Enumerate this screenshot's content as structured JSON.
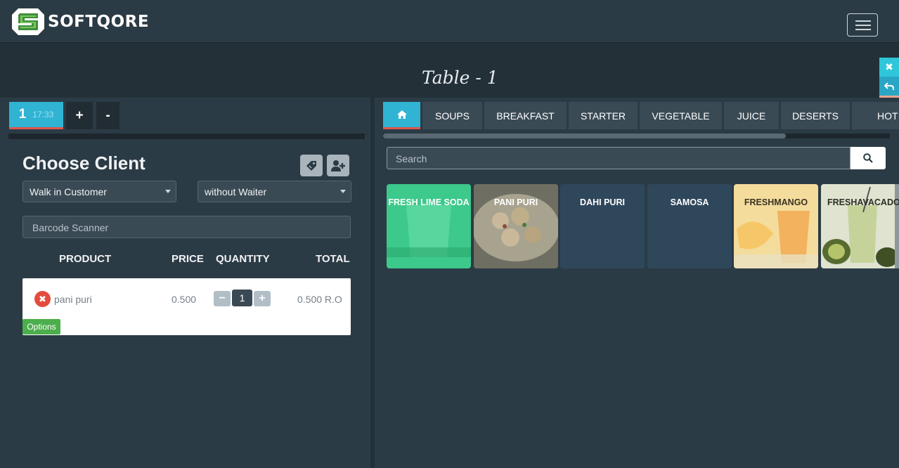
{
  "brand": {
    "name": "SOFTQORE"
  },
  "page": {
    "table_title": "Table - 1"
  },
  "order_tabs": {
    "active_number": "1",
    "active_time": "17:33",
    "add_label": "+",
    "remove_label": "-"
  },
  "client": {
    "heading": "Choose Client",
    "customer_select": "Walk in Customer",
    "waiter_select": "without Waiter",
    "barcode_placeholder": "Barcode Scanner"
  },
  "cart": {
    "columns": [
      "PRODUCT",
      "PRICE",
      "QUANTITY",
      "TOTAL"
    ],
    "items": [
      {
        "name": "pani puri",
        "price": "0.500",
        "quantity": "1",
        "total": "0.500 R.O",
        "options_label": "Options"
      }
    ]
  },
  "categories": [
    "SOUPS",
    "BREAKFAST",
    "STARTER",
    "VEGETABLE",
    "JUICE",
    "DESERTS",
    "HOT"
  ],
  "search": {
    "placeholder": "Search"
  },
  "products": [
    {
      "name": "FRESH LIME SODA",
      "color": "#3fc98a"
    },
    {
      "name": "PANI PURI",
      "color": "#8d8a73"
    },
    {
      "name": "DAHI PURI",
      "color": "#2f475b"
    },
    {
      "name": "SAMOSA",
      "color": "#2f475b"
    },
    {
      "name": "FRESHMANGO",
      "color": "#efc578"
    },
    {
      "name": "FRESHAVACADO",
      "color": "#cfd7b5"
    }
  ],
  "colors": {
    "accent": "#31b3d3",
    "active_underline": "#e0554b",
    "remove": "#e34b3c",
    "options": "#4cae4c",
    "side_close": "#2fc6da",
    "side_back": "#2aa6c4",
    "side_food": "#f0a58f"
  },
  "icons": {
    "home": "home-icon",
    "search": "search-icon",
    "tag": "tag-icon",
    "add_user": "add-user-icon",
    "close": "close-icon",
    "undo": "undo-icon",
    "food": "utensils-icon"
  }
}
